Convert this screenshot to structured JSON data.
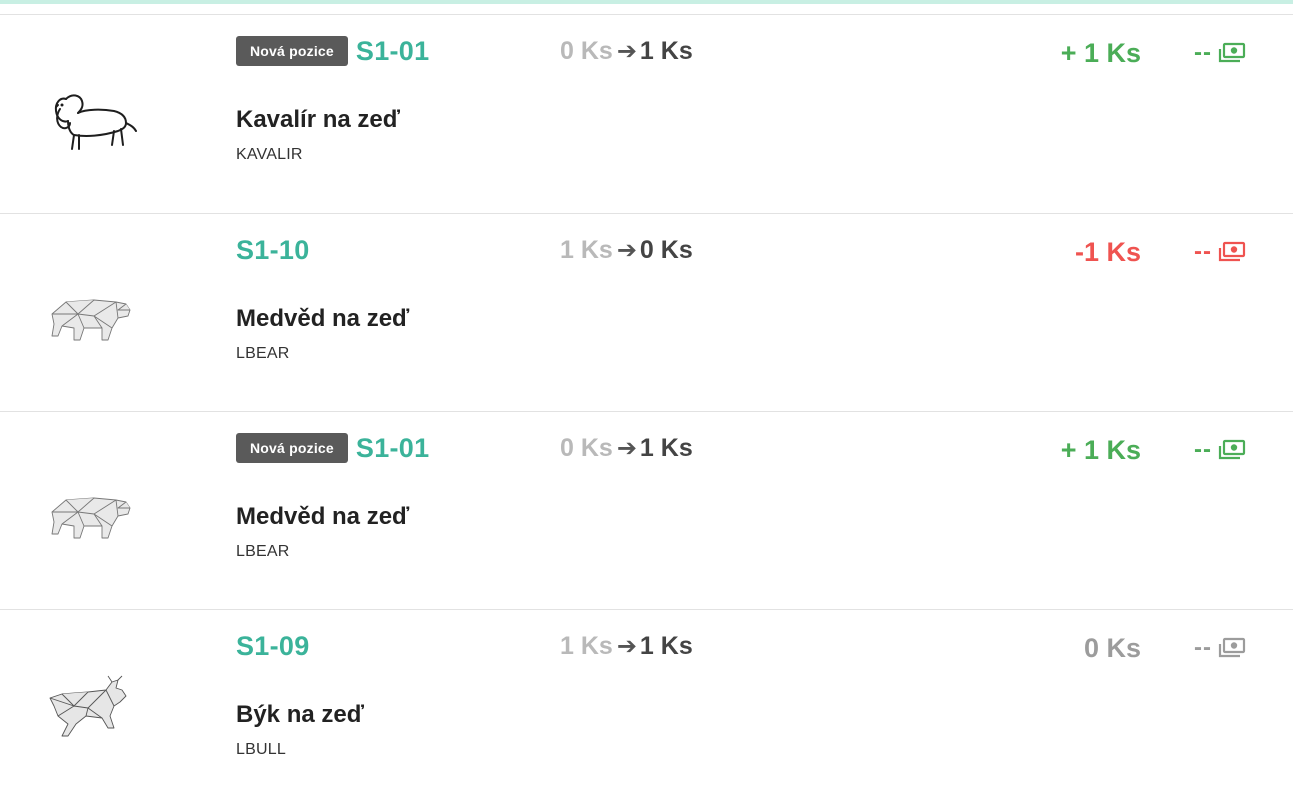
{
  "colors": {
    "accent": "#3bb39a",
    "positive": "#4bad57",
    "negative": "#ef5350",
    "neutral": "#9c9c9c",
    "badge_bg": "#5a5a5a"
  },
  "items": [
    {
      "badge": "Nová pozice",
      "code": "S1-01",
      "qty_from": "0 Ks",
      "qty_to": "1 Ks",
      "delta": "+ 1 Ks",
      "money": "--",
      "name": "Kavalír na zeď",
      "sku": "KAVALIR",
      "image_icon": "cavalier-dog-icon",
      "money_icon": "cash-icon"
    },
    {
      "badge": "",
      "code": "S1-10",
      "qty_from": "1 Ks",
      "qty_to": "0 Ks",
      "delta": "-1 Ks",
      "money": "--",
      "name": "Medvěd na zeď",
      "sku": "LBEAR",
      "image_icon": "polygon-bear-icon",
      "money_icon": "cash-icon"
    },
    {
      "badge": "Nová pozice",
      "code": "S1-01",
      "qty_from": "0 Ks",
      "qty_to": "1 Ks",
      "delta": "+ 1 Ks",
      "money": "--",
      "name": "Medvěd na zeď",
      "sku": "LBEAR",
      "image_icon": "polygon-bear-icon",
      "money_icon": "cash-icon"
    },
    {
      "badge": "",
      "code": "S1-09",
      "qty_from": "1 Ks",
      "qty_to": "1 Ks",
      "delta": "0 Ks",
      "money": "--",
      "name": "Býk na zeď",
      "sku": "LBULL",
      "image_icon": "polygon-bull-icon",
      "money_icon": "cash-icon"
    }
  ]
}
